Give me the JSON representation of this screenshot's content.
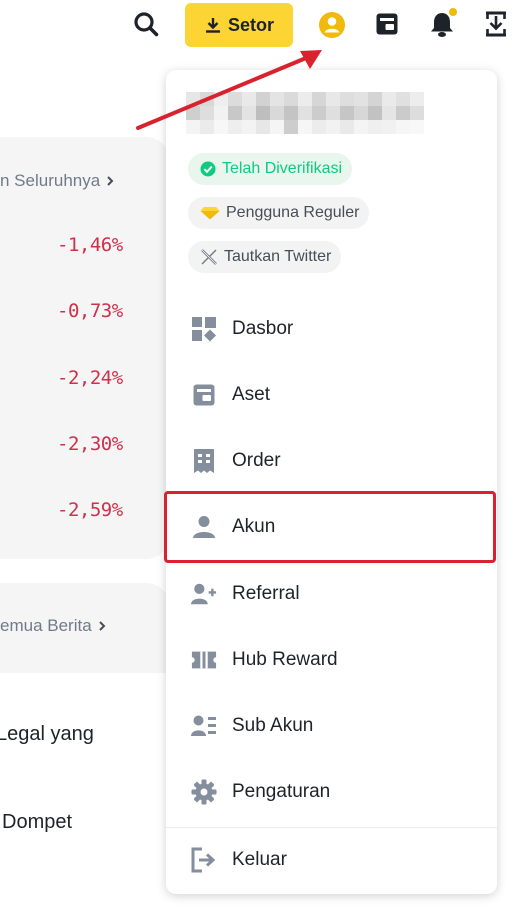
{
  "topbar": {
    "search_icon": "search-icon",
    "deposit_label": "Setor",
    "account_icon": "user-circle-icon",
    "wallet_icon": "wallet-icon",
    "notification_icon": "bell-icon",
    "download_icon": "download-app-icon",
    "brand_color": "#fcd535"
  },
  "background": {
    "market_see_all": "n Seluruhnya",
    "changes": [
      "-1,46%",
      "-0,73%",
      "-2,24%",
      "-2,30%",
      "-2,59%"
    ],
    "news_see_all": "emua Berita",
    "news_lines": [
      "Legal yang",
      "Dompet"
    ],
    "negative_color": "#cf304a"
  },
  "profile": {
    "badges": {
      "verified": "Telah Diverifikasi",
      "tier": "Pengguna Reguler",
      "twitter": "Tautkan Twitter"
    }
  },
  "menu": {
    "items": [
      {
        "label": "Dasbor",
        "icon": "dashboard-icon"
      },
      {
        "label": "Aset",
        "icon": "wallet-icon"
      },
      {
        "label": "Order",
        "icon": "order-icon"
      },
      {
        "label": "Akun",
        "icon": "user-icon"
      },
      {
        "label": "Referral",
        "icon": "add-user-icon"
      },
      {
        "label": "Hub Reward",
        "icon": "ticket-icon"
      },
      {
        "label": "Sub Akun",
        "icon": "sub-account-icon"
      },
      {
        "label": "Pengaturan",
        "icon": "gear-icon"
      }
    ],
    "logout_label": "Keluar",
    "highlighted_item": "Akun",
    "highlight_color": "#d9222e"
  }
}
